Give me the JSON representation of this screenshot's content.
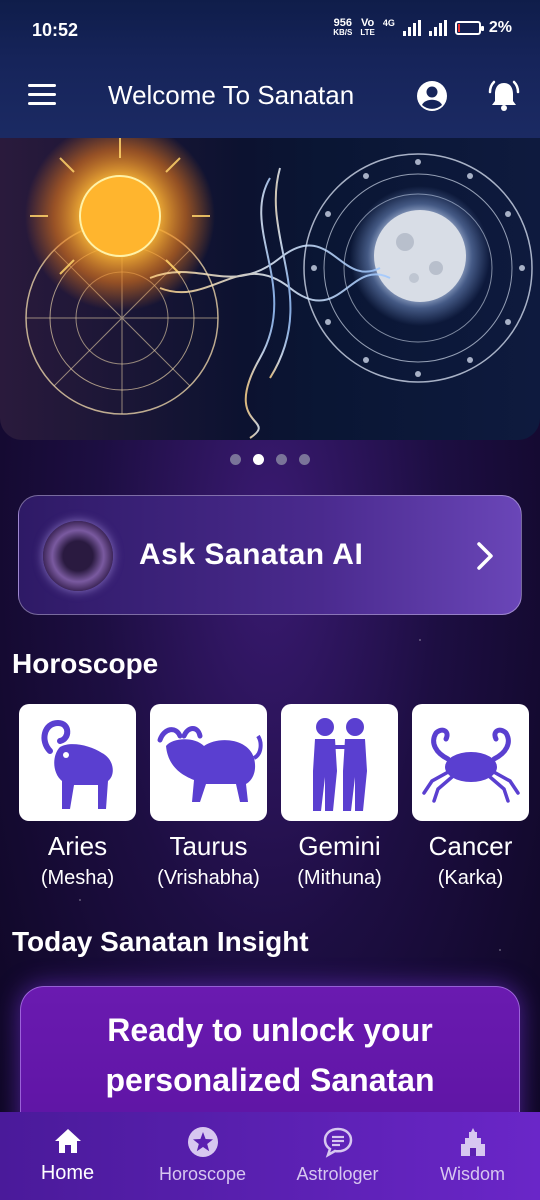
{
  "status_bar": {
    "time": "10:52",
    "net_speed": "956",
    "net_speed_unit": "KB/S",
    "vo": "Vo",
    "lte": "LTE",
    "network_4g": "4G",
    "battery": "2%"
  },
  "app_bar": {
    "title": "Welcome To Sanatan",
    "menu_icon": "menu-icon",
    "profile_icon": "profile-icon",
    "bell_icon": "bell-icon"
  },
  "banner": {
    "page_count": 4,
    "active_page": 2
  },
  "ask_ai": {
    "label": "Ask Sanatan AI"
  },
  "horoscope": {
    "title": "Horoscope",
    "signs": [
      {
        "name": "Aries",
        "alt": "(Mesha)"
      },
      {
        "name": "Taurus",
        "alt": "(Vrishabha)"
      },
      {
        "name": "Gemini",
        "alt": "(Mithuna)"
      },
      {
        "name": "Cancer",
        "alt": "(Karka)"
      }
    ]
  },
  "insight": {
    "title": "Today Sanatan Insight",
    "text": "Ready to unlock your personalized Sanatan insights?"
  },
  "bottom_nav": {
    "items": [
      {
        "label": "Home",
        "icon": "home-icon",
        "active": true
      },
      {
        "label": "Horoscope",
        "icon": "star-icon",
        "active": false
      },
      {
        "label": "Astrologer",
        "icon": "chat-icon",
        "active": false
      },
      {
        "label": "Wisdom",
        "icon": "temple-icon",
        "active": false
      }
    ]
  },
  "colors": {
    "background": "#1d0e42",
    "app_bar": "#16245a",
    "card_purple": "#4a2a8e",
    "insight_purple": "#6a1ab0",
    "nav": "#5a20b0",
    "zodiac_ink": "#5a3fd0"
  }
}
